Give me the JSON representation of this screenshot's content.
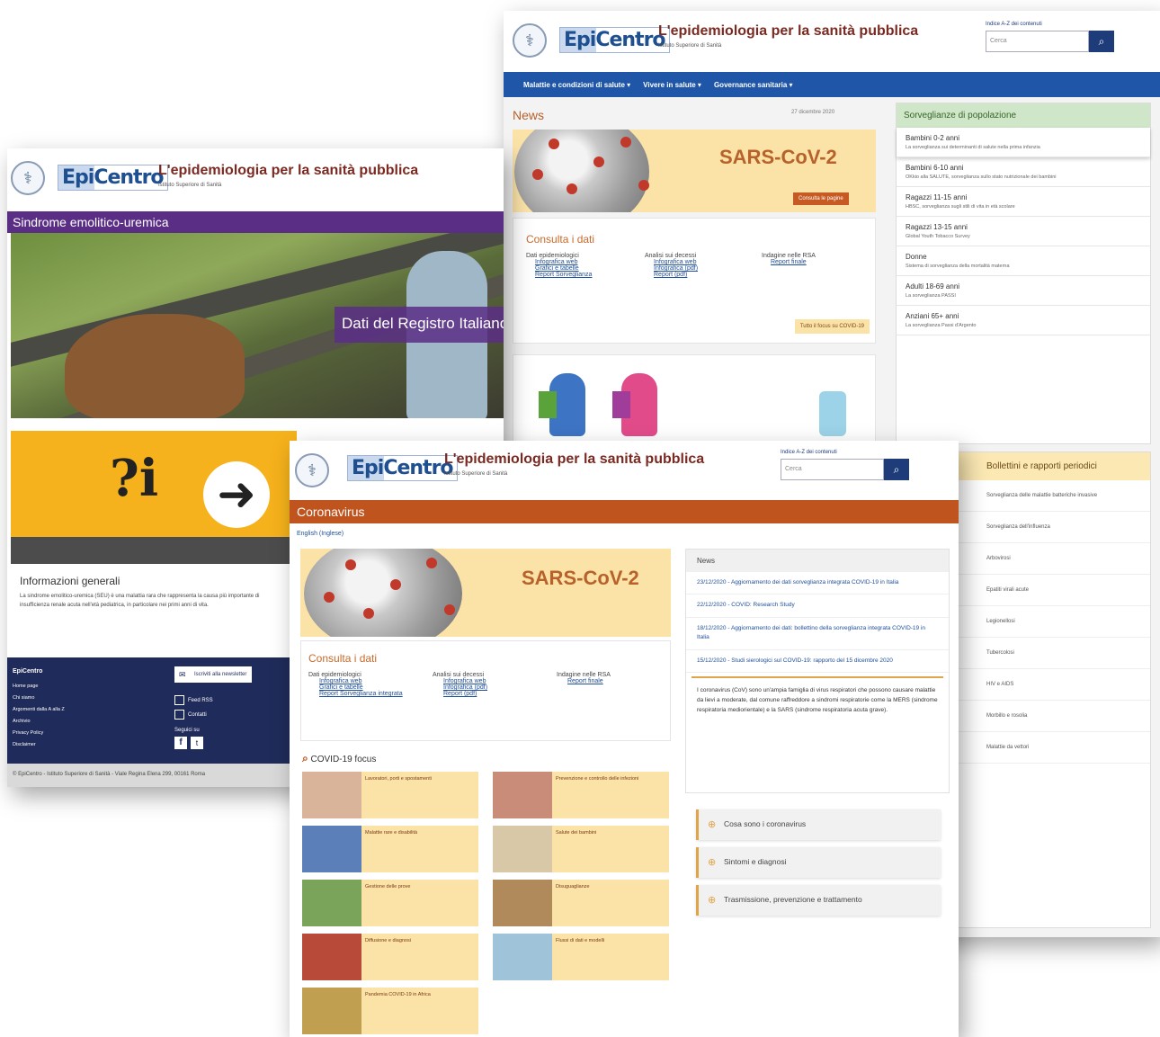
{
  "back_window": {
    "skip_link": "Indice A-Z dei contenuti",
    "logo": "EpiCentro",
    "title": "L'epidemiologia per la sanità pubblica",
    "subtitle": "Istituto Superiore di Sanità",
    "search_placeholder": "Cerca",
    "nav": [
      "Malattie e condizioni di salute ▾",
      "Vivere in salute ▾",
      "Governance sanitaria ▾"
    ],
    "news_heading": "News",
    "news_date": "27 dicembre 2020",
    "sars_label": "SARS-CoV-2",
    "sars_button": "Consulta le pagine",
    "consulta_heading": "Consulta i dati",
    "consulta_cols": [
      {
        "title": "Dati epidemiologici",
        "items": [
          "Infografica web",
          "Grafici e tabelle",
          "Report Sorveglianza"
        ]
      },
      {
        "title": "Analisi sui decessi",
        "items": [
          "Infografica web",
          "Infografica (pdf)",
          "Report (pdf)"
        ]
      },
      {
        "title": "Indagine nelle RSA",
        "items": [
          "Report finale"
        ]
      }
    ],
    "covid_link": "Tutto il focus su COVID-19",
    "surv_heading": "Sorveglianze di popolazione",
    "surv_items": [
      {
        "title": "Bambini 0-2 anni",
        "desc": "La sorveglianza sui determinanti di salute nella prima infanzia"
      },
      {
        "title": "Bambini 6-10 anni",
        "desc": "OKkio alla SALUTE, sorveglianza sullo stato nutrizionale dei bambini"
      },
      {
        "title": "Ragazzi 11-15 anni",
        "desc": "HBSC, sorveglianza sugli stili di vita in età scolare"
      },
      {
        "title": "Ragazzi 13-15 anni",
        "desc": "Global Youth Tobacco Survey"
      },
      {
        "title": "Donne",
        "desc": "Sistema di sorveglianza della mortalità materna"
      },
      {
        "title": "Adulti 18-69 anni",
        "desc": "La sorveglianza PASSI"
      },
      {
        "title": "Anziani 65+ anni",
        "desc": "La sorveglianza Passi d'Argento"
      }
    ],
    "bulletins_heading": "Bollettini e rapporti periodici",
    "bulletins_items": [
      "Sorveglianza delle malattie batteriche invasive",
      "Sorveglianza dell'influenza",
      "Arbovirosi",
      "Epatiti virali acute",
      "Legionellosi",
      "Tubercolosi",
      "HIV e AIDS",
      "Morbillo e rosolia",
      "Malattie da vettori"
    ]
  },
  "left_window": {
    "logo": "EpiCentro",
    "title": "L'epidemiologia per la sanità pubblica",
    "subtitle": "Istituto Superiore di Sanità",
    "page_title": "Sindrome emolitico-uremica",
    "hero_caption": "Dati del Registro Italiano",
    "sign_text": "?i",
    "info_heading": "Informazioni generali",
    "info_text": "La sindrome emolitico-uremica (SEU) è una malattia rara che rappresenta la causa più importante di insufficienza renale acuta nell'età pediatrica, in particolare nei primi anni di vita.",
    "footer_heading": "EpiCentro",
    "footer_links": [
      "Home page",
      "Chi siamo",
      "Argomenti dalla A alla Z",
      "Archivio",
      "Privacy Policy",
      "Disclaimer"
    ],
    "newsletter_button": "Iscriviti alla newsletter",
    "rss_label": "Feed RSS",
    "contact_label": "Contatti",
    "social_label": "Seguici su",
    "bottom_text": "© EpiCentro - Istituto Superiore di Sanità - Viale Regina Elena 299, 00161 Roma"
  },
  "front_window": {
    "skip_link": "Indice A-Z dei contenuti",
    "logo": "EpiCentro",
    "title": "L'epidemiologia per la sanità pubblica",
    "subtitle": "Istituto Superiore di Sanità",
    "search_placeholder": "Cerca",
    "page_title": "Coronavirus",
    "lang_link": "English (Inglese)",
    "sars_label": "SARS-CoV-2",
    "consulta_heading": "Consulta i dati",
    "consulta_cols": [
      {
        "title": "Dati epidemiologici",
        "items": [
          "Infografica web",
          "Grafici e tabelle",
          "Report Sorveglianza integrata"
        ]
      },
      {
        "title": "Analisi sui decessi",
        "items": [
          "Infografica web",
          "Infografica (pdf)",
          "Report (pdf)"
        ]
      },
      {
        "title": "Indagine nelle RSA",
        "items": [
          "Report finale"
        ]
      }
    ],
    "focus_heading": "COVID-19 focus",
    "focus_tiles": [
      "Lavoratori, porti e spostamenti",
      "Prevenzione e controllo delle infezioni",
      "Malattie rare e disabilità",
      "Salute dei bambini",
      "Gestione delle prove",
      "Disuguaglianze",
      "Diffusione e diagnosi",
      "Flussi di dati e modelli",
      "Pandemia COVID-19 in Africa"
    ],
    "news_heading": "News",
    "news_items": [
      "23/12/2020 - Aggiornamento dei dati sorveglianza integrata COVID-19 in Italia",
      "22/12/2020 - COVID: Research Study",
      "18/12/2020 - Aggiornamento dei dati: bollettino della sorveglianza integrata COVID-19 in Italia",
      "15/12/2020 - Studi sierologici sul COVID-19: rapporto del 15 dicembre 2020"
    ],
    "intro_text": "I coronavirus (CoV) sono un'ampia famiglia di virus respiratori che possono causare malattie da lievi a moderate, dal comune raffreddore a sindromi respiratorie come la MERS (sindrome respiratoria mediorientale) e la SARS (sindrome respiratoria acuta grave).",
    "accordion": [
      "Cosa sono i coronavirus",
      "Sintomi e diagnosi",
      "Trasmissione, prevenzione e trattamento"
    ]
  }
}
